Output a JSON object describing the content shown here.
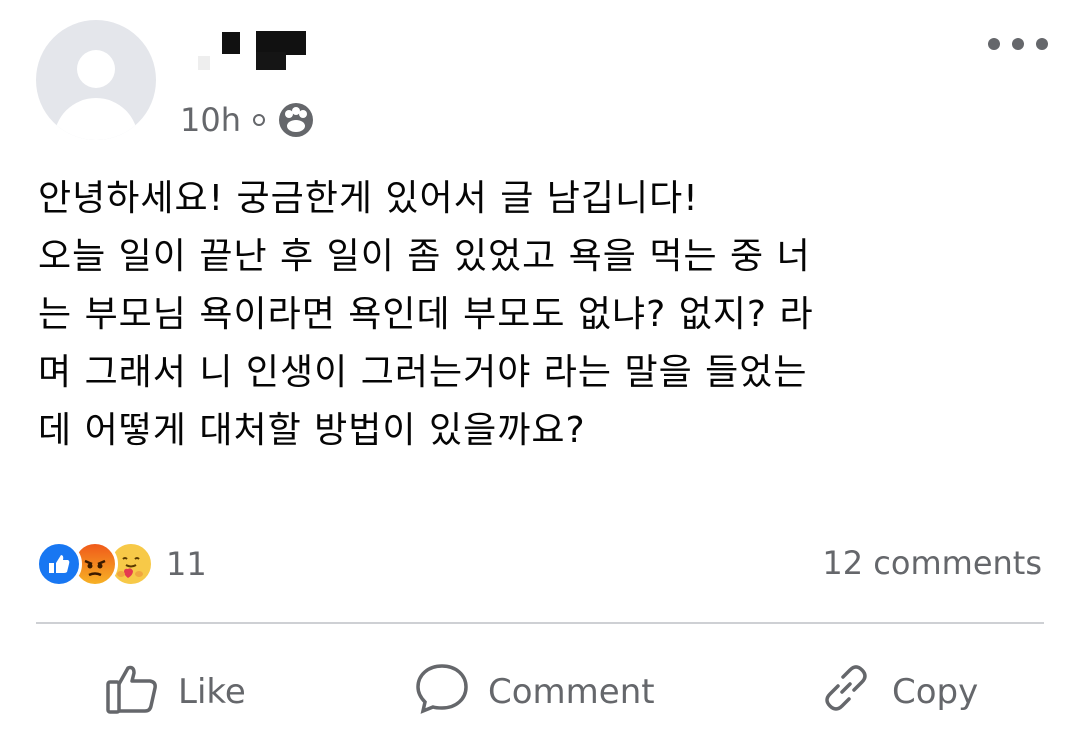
{
  "post": {
    "timestamp": "10h",
    "separator": "·",
    "privacy_icon": "friends-icon",
    "body": "안녕하세요! 궁금한게 있어서 글 남깁니다!\n오늘 일이 끝난 후 일이 좀 있었고 욕을 먹는 중 너\n는 부모님 욕이라면 욕인데 부모도 없냐? 없지? 라\n며 그래서 니 인생이 그러는거야 라는 말을 들었는\n데 어떻게 대처할 방법이 있을까요?"
  },
  "reactions": {
    "icons": [
      "like-icon",
      "angry-icon",
      "care-icon"
    ],
    "count": "11"
  },
  "comments": {
    "count_label": "12 comments"
  },
  "actions": {
    "like": "Like",
    "comment": "Comment",
    "copy": "Copy"
  },
  "colors": {
    "like_blue": "#1877f2",
    "secondary_text": "#65676b",
    "divider": "#ced0d4"
  }
}
